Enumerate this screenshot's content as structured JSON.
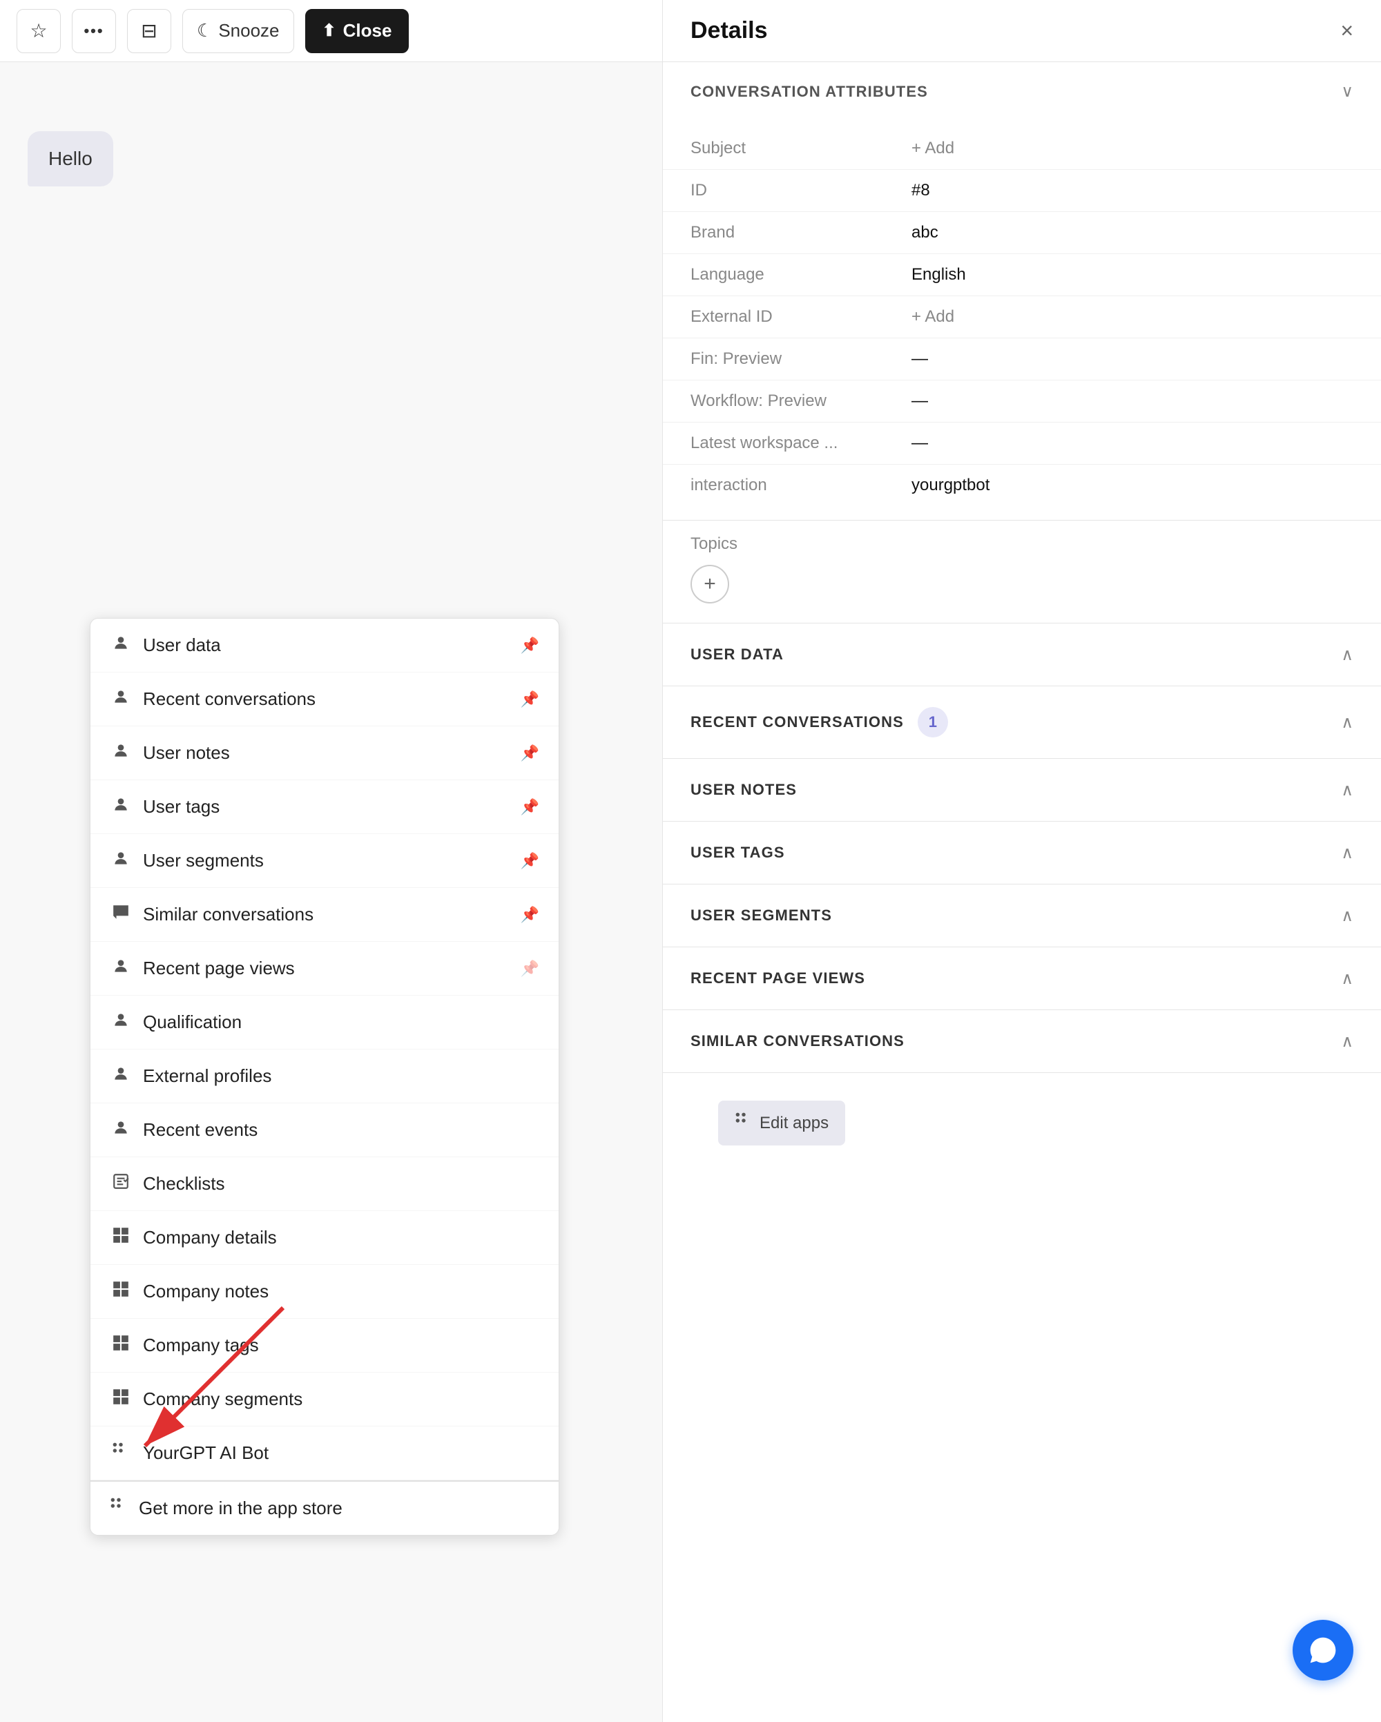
{
  "toolbar": {
    "star_icon": "☆",
    "more_icon": "•••",
    "inbox_icon": "⊟",
    "snooze_label": "Snooze",
    "snooze_icon": "☾",
    "close_label": "Close",
    "close_icon": "⬆"
  },
  "chat": {
    "bubble_text": "Hello"
  },
  "dropdown": {
    "items": [
      {
        "icon": "person",
        "label": "User data",
        "pinned": true
      },
      {
        "icon": "person",
        "label": "Recent conversations",
        "pinned": true
      },
      {
        "icon": "person",
        "label": "User notes",
        "pinned": true
      },
      {
        "icon": "person",
        "label": "User tags",
        "pinned": true
      },
      {
        "icon": "person",
        "label": "User segments",
        "pinned": true
      },
      {
        "icon": "chat",
        "label": "Similar conversations",
        "pinned": true
      },
      {
        "icon": "person",
        "label": "Recent page views",
        "pinned": false
      },
      {
        "icon": "person",
        "label": "Qualification",
        "pinned": false
      },
      {
        "icon": "person",
        "label": "External profiles",
        "pinned": false
      },
      {
        "icon": "person",
        "label": "Recent events",
        "pinned": false
      },
      {
        "icon": "checklist",
        "label": "Checklists",
        "pinned": false
      },
      {
        "icon": "grid",
        "label": "Company details",
        "pinned": false
      },
      {
        "icon": "grid",
        "label": "Company notes",
        "pinned": false
      },
      {
        "icon": "grid",
        "label": "Company tags",
        "pinned": false
      },
      {
        "icon": "grid",
        "label": "Company segments",
        "pinned": false
      },
      {
        "icon": "dots",
        "label": "YourGPT AI Bot",
        "pinned": false
      }
    ],
    "footer_icon": "⊞",
    "footer_label": "Get more in the app store"
  },
  "details": {
    "title": "Details",
    "close_icon": "×",
    "conversation_attributes": {
      "section_title": "CONVERSATION ATTRIBUTES",
      "chevron": "∨",
      "rows": [
        {
          "label": "Subject",
          "value": "+ Add",
          "is_add": true
        },
        {
          "label": "ID",
          "value": "#8",
          "is_add": false
        },
        {
          "label": "Brand",
          "value": "abc",
          "is_add": false
        },
        {
          "label": "Language",
          "value": "English",
          "is_add": false
        },
        {
          "label": "External ID",
          "value": "+ Add",
          "is_add": true
        },
        {
          "label": "Fin: Preview",
          "value": "—",
          "is_add": false
        },
        {
          "label": "Workflow: Preview",
          "value": "—",
          "is_add": false
        },
        {
          "label": "Latest workspace ...",
          "value": "—",
          "is_add": false
        },
        {
          "label": "interaction",
          "value": "yourgptbot",
          "is_add": false
        }
      ]
    },
    "topics": {
      "label": "Topics",
      "add_btn": "+"
    },
    "sections": [
      {
        "title": "USER DATA",
        "badge": null,
        "chevron": "∧"
      },
      {
        "title": "RECENT CONVERSATIONS",
        "badge": "1",
        "chevron": "∧"
      },
      {
        "title": "USER NOTES",
        "badge": null,
        "chevron": "∧"
      },
      {
        "title": "USER TAGS",
        "badge": null,
        "chevron": "∧"
      },
      {
        "title": "USER SEGMENTS",
        "badge": null,
        "chevron": "∧"
      },
      {
        "title": "RECENT PAGE VIEWS",
        "badge": null,
        "chevron": "∧"
      },
      {
        "title": "SIMILAR CONVERSATIONS",
        "badge": null,
        "chevron": "∧"
      }
    ],
    "edit_apps_icon": "⊞",
    "edit_apps_label": "Edit apps"
  }
}
